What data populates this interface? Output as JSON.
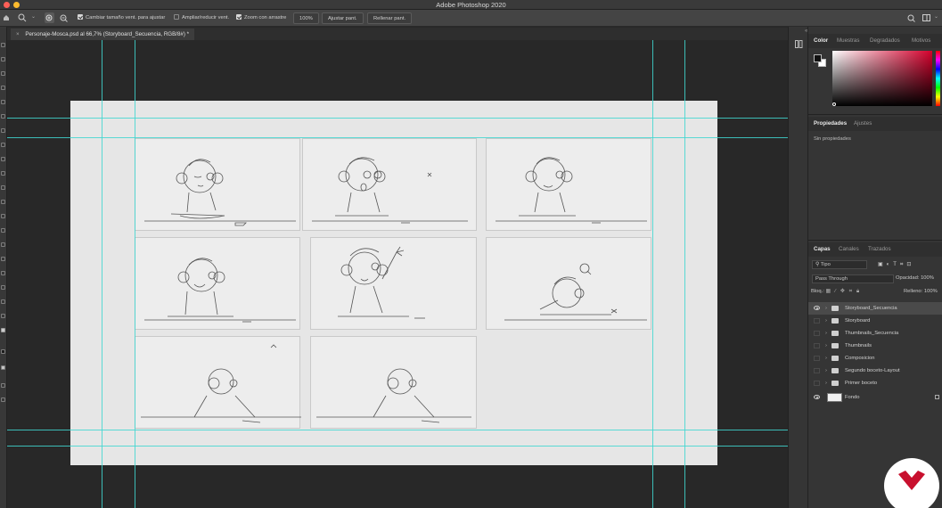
{
  "app": {
    "title": "Adobe Photoshop 2020",
    "traffic_colors": [
      "#ff5f57",
      "#febc2e",
      "#28c840"
    ]
  },
  "options_bar": {
    "resize_windows_label": "Cambiar tamaño vent. para ajustar",
    "zoom_all_windows_label": "Ampliar/reducir vent.",
    "scrubby_zoom_label": "Zoom con arrastre",
    "zoom_percent": "100%",
    "fit_screen_label": "Ajustar pant.",
    "fill_screen_label": "Rellenar pant."
  },
  "document_tab": {
    "close_glyph": "×",
    "title": "Personaje-Mosca.psd al 66,7% (Storyboard_Secuencia, RGB/8#) *"
  },
  "color_panel": {
    "tabs": [
      "Color",
      "Muestras",
      "Degradados",
      "Motivos"
    ],
    "active_tab": "Color",
    "foreground": "#111111",
    "background": "#ffffff",
    "hue_color": "#d4002c"
  },
  "properties_panel": {
    "tabs": [
      "Propiedades",
      "Ajustes"
    ],
    "active_tab": "Propiedades",
    "empty_text": "Sin propiedades"
  },
  "layers_panel": {
    "tabs": [
      "Capas",
      "Canales",
      "Trazados"
    ],
    "active_tab": "Capas",
    "filter_label": "Tipo",
    "blend_mode": "Pass Through",
    "opacity_label": "Opacidad:",
    "opacity_value": "100%",
    "lock_label": "Bloq.:",
    "fill_label": "Relleno:",
    "fill_value": "100%",
    "layers": [
      {
        "name": "Storyboard_Secuencia",
        "visible": true,
        "type": "group",
        "selected": true
      },
      {
        "name": "Storyboard",
        "visible": false,
        "type": "group"
      },
      {
        "name": "Thumbnails_Secuencia",
        "visible": false,
        "type": "group"
      },
      {
        "name": "Thumbnails",
        "visible": false,
        "type": "group"
      },
      {
        "name": "Composicion",
        "visible": false,
        "type": "group"
      },
      {
        "name": "Segundo boceto-Layout",
        "visible": false,
        "type": "group"
      },
      {
        "name": "Primer boceto",
        "visible": false,
        "type": "group"
      },
      {
        "name": "Fondo",
        "visible": true,
        "type": "background",
        "locked": true
      }
    ]
  },
  "canvas": {
    "background": "#e6e6e6",
    "guide_color": "#3fd6d0",
    "storyboard_panels": 8
  }
}
